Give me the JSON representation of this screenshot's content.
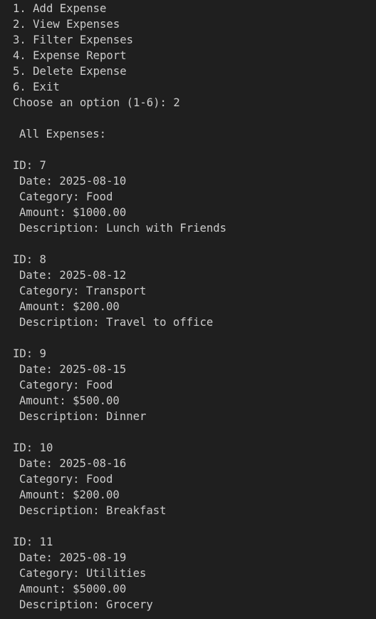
{
  "menu": {
    "items": [
      "1. Add Expense",
      "2. View Expenses",
      "3. Filter Expenses",
      "4. Expense Report",
      "5. Delete Expense",
      "6. Exit"
    ],
    "prompt": "Choose an option (1-6): 2"
  },
  "listing": {
    "heading": "All Expenses:",
    "expenses": [
      {
        "id": "ID: 7",
        "date": "Date: 2025-08-10",
        "category": "Category: Food",
        "amount": "Amount: $1000.00",
        "description": "Description: Lunch with Friends"
      },
      {
        "id": "ID: 8",
        "date": "Date: 2025-08-12",
        "category": "Category: Transport",
        "amount": "Amount: $200.00",
        "description": "Description: Travel to office"
      },
      {
        "id": "ID: 9",
        "date": "Date: 2025-08-15",
        "category": "Category: Food",
        "amount": "Amount: $500.00",
        "description": "Description: Dinner"
      },
      {
        "id": "ID: 10",
        "date": "Date: 2025-08-16",
        "category": "Category: Food",
        "amount": "Amount: $200.00",
        "description": "Description: Breakfast"
      },
      {
        "id": "ID: 11",
        "date": "Date: 2025-08-19",
        "category": "Category: Utilities",
        "amount": "Amount: $5000.00",
        "description": "Description: Grocery"
      }
    ]
  },
  "colors": {
    "background": "#1f1f1f",
    "text": "#cccccc"
  }
}
